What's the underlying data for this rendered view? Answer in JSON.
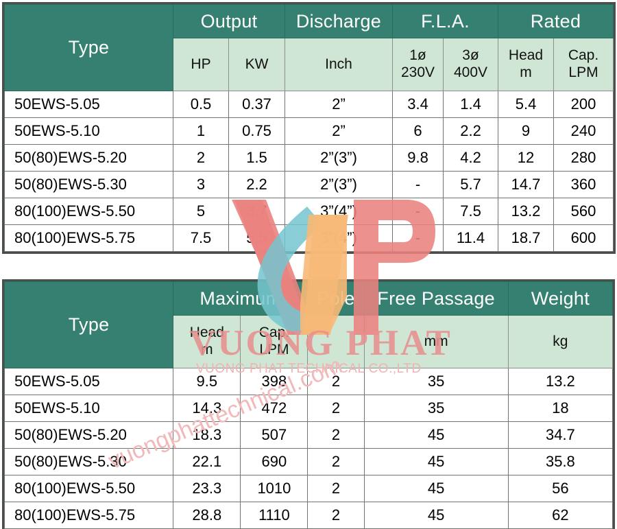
{
  "tables": [
    {
      "id": "electrical-specs",
      "group_headers": [
        {
          "label": "Type",
          "span": 1
        },
        {
          "label": "Output",
          "span": 2
        },
        {
          "label": "Discharge",
          "span": 1
        },
        {
          "label": "F.L.A.",
          "span": 2
        },
        {
          "label": "Rated",
          "span": 2
        }
      ],
      "sub_headers": [
        {
          "line1": "",
          "line2": ""
        },
        {
          "line1": "HP",
          "line2": ""
        },
        {
          "line1": "KW",
          "line2": ""
        },
        {
          "line1": "Inch",
          "line2": ""
        },
        {
          "line1": "1ø",
          "line2": "230V"
        },
        {
          "line1": "3ø",
          "line2": "400V"
        },
        {
          "line1": "Head",
          "line2": "m"
        },
        {
          "line1": "Cap.",
          "line2": "LPM"
        }
      ],
      "rows": [
        [
          "50EWS-5.05",
          "0.5",
          "0.37",
          "2”",
          "3.4",
          "1.4",
          "5.4",
          "200"
        ],
        [
          "50EWS-5.10",
          "1",
          "0.75",
          "2”",
          "6",
          "2.2",
          "9",
          "240"
        ],
        [
          "50(80)EWS-5.20",
          "2",
          "1.5",
          "2”(3”)",
          "9.8",
          "4.2",
          "12",
          "280"
        ],
        [
          "50(80)EWS-5.30",
          "3",
          "2.2",
          "2”(3”)",
          "-",
          "5.7",
          "14.7",
          "360"
        ],
        [
          "80(100)EWS-5.50",
          "5",
          "3.7",
          "3”(4”)",
          "-",
          "7.5",
          "13.2",
          "560"
        ],
        [
          "80(100)EWS-5.75",
          "7.5",
          "5.5",
          "3”(4”)",
          "-",
          "11.4",
          "18.7",
          "600"
        ]
      ]
    },
    {
      "id": "performance-specs",
      "group_headers": [
        {
          "label": "Type",
          "span": 1
        },
        {
          "label": "Maximum",
          "span": 2
        },
        {
          "label": "Pole",
          "span": 1
        },
        {
          "label": "Free Passage",
          "span": 1
        },
        {
          "label": "Weight",
          "span": 1
        }
      ],
      "sub_headers": [
        {
          "line1": "",
          "line2": ""
        },
        {
          "line1": "Head",
          "line2": "m"
        },
        {
          "line1": "Cap.",
          "line2": "LPM"
        },
        {
          "line1": "",
          "line2": ""
        },
        {
          "line1": "mm",
          "line2": ""
        },
        {
          "line1": "kg",
          "line2": ""
        }
      ],
      "rows": [
        [
          "50EWS-5.05",
          "9.5",
          "398",
          "2",
          "35",
          "13.2"
        ],
        [
          "50EWS-5.10",
          "14.3",
          "472",
          "2",
          "35",
          "18"
        ],
        [
          "50(80)EWS-5.20",
          "18.3",
          "507",
          "2",
          "45",
          "34.7"
        ],
        [
          "50(80)EWS-5.30",
          "22.1",
          "690",
          "2",
          "45",
          "35.8"
        ],
        [
          "80(100)EWS-5.50",
          "23.3",
          "1010",
          "2",
          "45",
          "56"
        ],
        [
          "80(100)EWS-5.75",
          "28.8",
          "1110",
          "2",
          "45",
          "62"
        ]
      ]
    }
  ],
  "watermark": {
    "logo_name": "vp-logo-icon",
    "brand_text": "VUONG PHAT",
    "company_text": "VUONG PHAT TECHNICAL CO.,LTD",
    "website_text": "vuongphattechnical.com",
    "colors": {
      "logo_pink": "#ea8280",
      "logo_teal": "#74c6cf",
      "logo_orange": "#f7b977",
      "brand_red": "#e8918f",
      "url_pink": "#f1b9b9"
    }
  },
  "theme": {
    "header_green": "#358070",
    "subheader_green": "#cfe6d4",
    "border_gray": "#6f7471",
    "frame_gray": "#4a4f4c"
  }
}
